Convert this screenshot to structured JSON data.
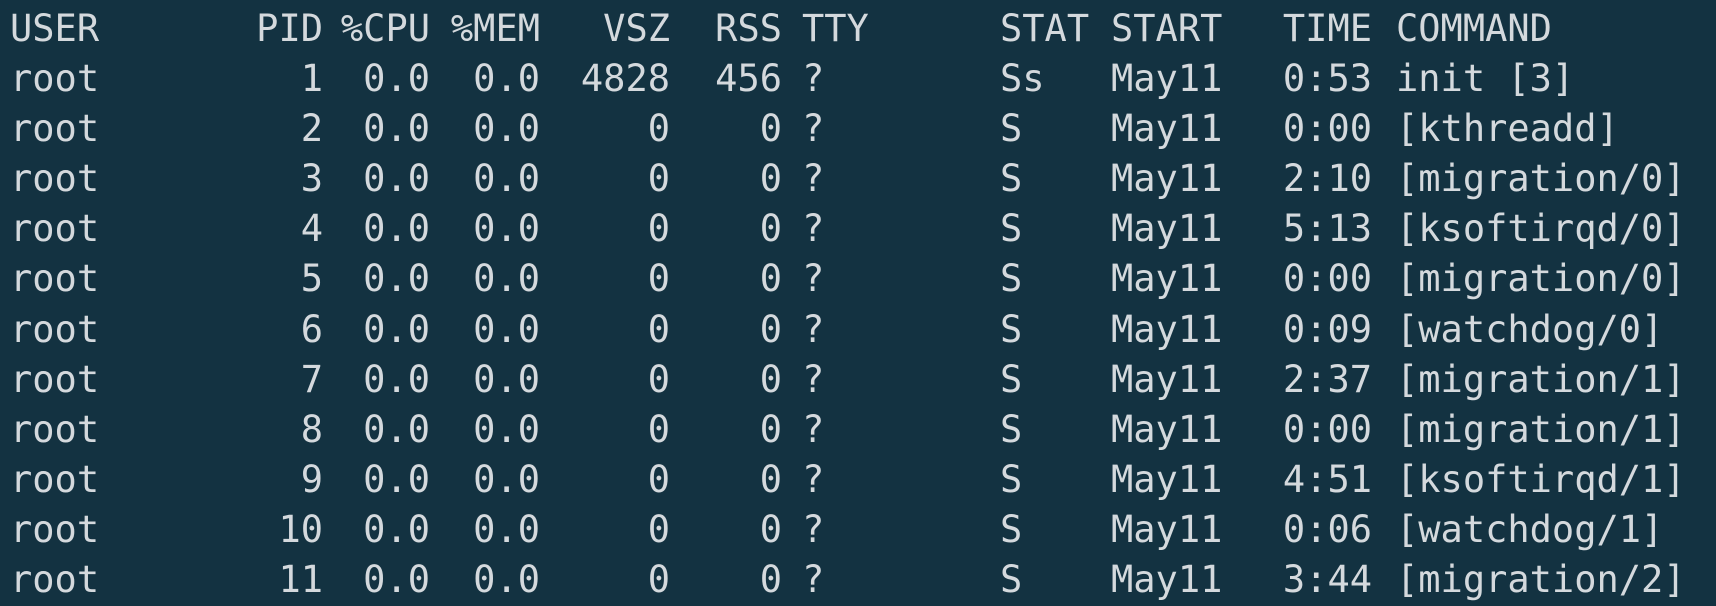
{
  "window": {
    "background": "#133241",
    "foreground": "#d4d9dd"
  },
  "columns": {
    "user": "USER",
    "pid": "PID",
    "cpu": "%CPU",
    "mem": "%MEM",
    "vsz": "VSZ",
    "rss": "RSS",
    "tty": "TTY",
    "stat": "STAT",
    "start": "START",
    "time": "TIME",
    "command": "COMMAND"
  },
  "rows": [
    {
      "user": "root",
      "pid": "1",
      "cpu": "0.0",
      "mem": "0.0",
      "vsz": "4828",
      "rss": "456",
      "tty": "?",
      "stat": "Ss",
      "start": "May11",
      "time": "0:53",
      "command": "init [3]"
    },
    {
      "user": "root",
      "pid": "2",
      "cpu": "0.0",
      "mem": "0.0",
      "vsz": "0",
      "rss": "0",
      "tty": "?",
      "stat": "S",
      "start": "May11",
      "time": "0:00",
      "command": "[kthreadd]"
    },
    {
      "user": "root",
      "pid": "3",
      "cpu": "0.0",
      "mem": "0.0",
      "vsz": "0",
      "rss": "0",
      "tty": "?",
      "stat": "S",
      "start": "May11",
      "time": "2:10",
      "command": "[migration/0]"
    },
    {
      "user": "root",
      "pid": "4",
      "cpu": "0.0",
      "mem": "0.0",
      "vsz": "0",
      "rss": "0",
      "tty": "?",
      "stat": "S",
      "start": "May11",
      "time": "5:13",
      "command": "[ksoftirqd/0]"
    },
    {
      "user": "root",
      "pid": "5",
      "cpu": "0.0",
      "mem": "0.0",
      "vsz": "0",
      "rss": "0",
      "tty": "?",
      "stat": "S",
      "start": "May11",
      "time": "0:00",
      "command": "[migration/0]"
    },
    {
      "user": "root",
      "pid": "6",
      "cpu": "0.0",
      "mem": "0.0",
      "vsz": "0",
      "rss": "0",
      "tty": "?",
      "stat": "S",
      "start": "May11",
      "time": "0:09",
      "command": "[watchdog/0]"
    },
    {
      "user": "root",
      "pid": "7",
      "cpu": "0.0",
      "mem": "0.0",
      "vsz": "0",
      "rss": "0",
      "tty": "?",
      "stat": "S",
      "start": "May11",
      "time": "2:37",
      "command": "[migration/1]"
    },
    {
      "user": "root",
      "pid": "8",
      "cpu": "0.0",
      "mem": "0.0",
      "vsz": "0",
      "rss": "0",
      "tty": "?",
      "stat": "S",
      "start": "May11",
      "time": "0:00",
      "command": "[migration/1]"
    },
    {
      "user": "root",
      "pid": "9",
      "cpu": "0.0",
      "mem": "0.0",
      "vsz": "0",
      "rss": "0",
      "tty": "?",
      "stat": "S",
      "start": "May11",
      "time": "4:51",
      "command": "[ksoftirqd/1]"
    },
    {
      "user": "root",
      "pid": "10",
      "cpu": "0.0",
      "mem": "0.0",
      "vsz": "0",
      "rss": "0",
      "tty": "?",
      "stat": "S",
      "start": "May11",
      "time": "0:06",
      "command": "[watchdog/1]"
    },
    {
      "user": "root",
      "pid": "11",
      "cpu": "0.0",
      "mem": "0.0",
      "vsz": "0",
      "rss": "0",
      "tty": "?",
      "stat": "S",
      "start": "May11",
      "time": "3:44",
      "command": "[migration/2]"
    }
  ]
}
